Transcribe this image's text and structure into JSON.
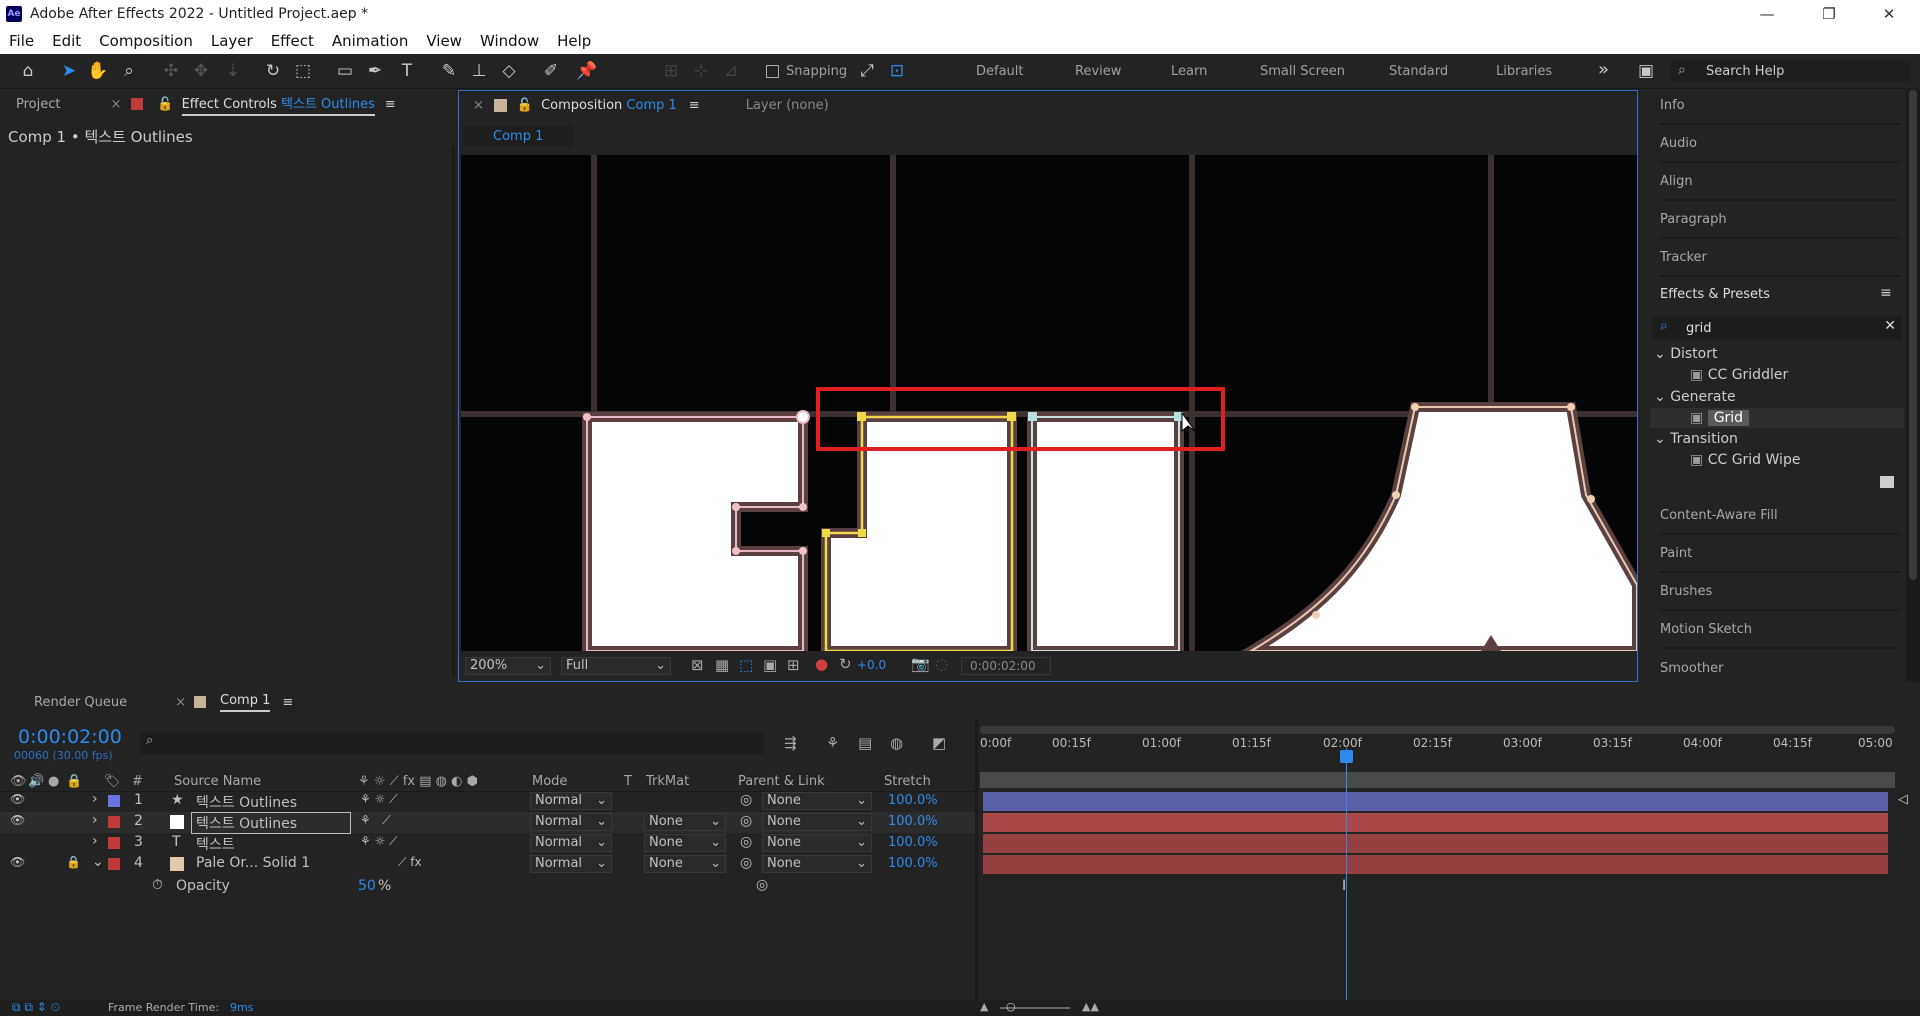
{
  "window": {
    "title": "Adobe After Effects 2022 - Untitled Project.aep *",
    "app_icon": "Ae",
    "minimize": "—",
    "maximize": "❐",
    "close": "✕"
  },
  "menu": [
    "File",
    "Edit",
    "Composition",
    "Layer",
    "Effect",
    "Animation",
    "View",
    "Window",
    "Help"
  ],
  "toolbar": {
    "snapping": "Snapping",
    "workspaces": [
      "Default",
      "Review",
      "Learn",
      "Small Screen",
      "Standard",
      "Libraries"
    ],
    "more": "»",
    "search_placeholder": "Search Help"
  },
  "left_panel": {
    "tab_project": "Project",
    "tab_effect_controls": "Effect Controls",
    "effect_controls_layer": "텍스트 Outlines",
    "breadcrumb": "Comp 1 • 텍스트 Outlines"
  },
  "composition": {
    "tab_label": "Composition",
    "tab_comp": "Comp 1",
    "layer_tab": "Layer (none)",
    "comp_chip": "Comp 1",
    "zoom": "200%",
    "resolution": "Full",
    "exposure": "+0.0",
    "timecode": "0:00:02:00"
  },
  "right_panel": {
    "items_top": [
      "Info",
      "Audio",
      "Align",
      "Paragraph",
      "Tracker"
    ],
    "effects_title": "Effects & Presets",
    "search_value": "grid",
    "tree": [
      {
        "category": "Distort",
        "item": "CC Griddler"
      },
      {
        "category": "Generate",
        "item": "Grid"
      },
      {
        "category": "Transition",
        "item": "CC Grid Wipe"
      }
    ],
    "items_bottom": [
      "Content-Aware Fill",
      "Paint",
      "Brushes",
      "Motion Sketch",
      "Smoother"
    ]
  },
  "timeline": {
    "tab_render_queue": "Render Queue",
    "tab_comp": "Comp 1",
    "current_time": "0:00:02:00",
    "frame_info": "00060 (30.00 fps)",
    "columns": {
      "hash": "#",
      "source_name": "Source Name",
      "mode": "Mode",
      "t": "T",
      "trkmat": "TrkMat",
      "parent": "Parent & Link",
      "stretch": "Stretch"
    },
    "layers": [
      {
        "num": "1",
        "name": "텍스트 Outlines",
        "mode": "Normal",
        "trkmat": "",
        "parent": "None",
        "stretch": "100.0%",
        "label_color": "#6a73e0",
        "icon": "★",
        "bar_color": "#5a5fa8"
      },
      {
        "num": "2",
        "name": "텍스트 Outlines",
        "mode": "Normal",
        "trkmat": "None",
        "parent": "None",
        "stretch": "100.0%",
        "label_color": "#c03a3a",
        "icon": "□",
        "bar_color": "#a84848"
      },
      {
        "num": "3",
        "name": "텍스트",
        "mode": "Normal",
        "trkmat": "None",
        "parent": "None",
        "stretch": "100.0%",
        "label_color": "#c03a3a",
        "icon": "T",
        "bar_color": "#944040"
      },
      {
        "num": "4",
        "name": "Pale Or... Solid 1",
        "mode": "Normal",
        "trkmat": "None",
        "parent": "None",
        "stretch": "100.0%",
        "label_color": "#c03a3a",
        "icon": "■",
        "bar_color": "#944040"
      }
    ],
    "property": {
      "name": "Opacity",
      "value": "50",
      "unit": "%"
    },
    "ruler": [
      "0:00f",
      "00:15f",
      "01:00f",
      "01:15f",
      "02:00f",
      "02:15f",
      "03:00f",
      "03:15f",
      "04:00f",
      "04:15f",
      "05:00"
    ],
    "footer": {
      "label": "Frame Render Time:",
      "value": "9ms"
    }
  }
}
